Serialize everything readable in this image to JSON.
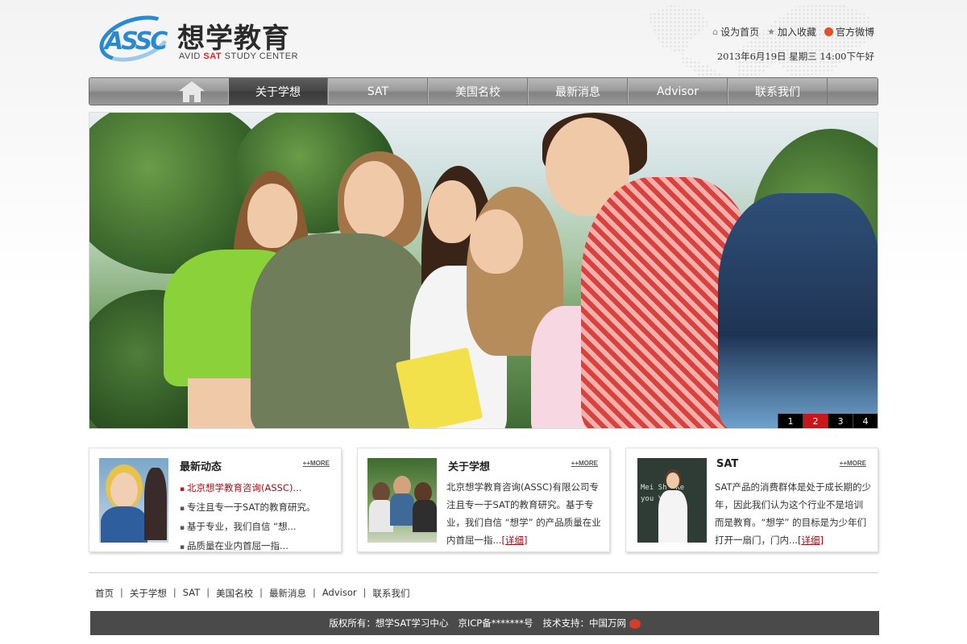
{
  "header": {
    "logo_abbr": "ASSC",
    "logo_cn": "想学教育",
    "logo_en_prefix": "AVID ",
    "logo_en_highlight": "SAT",
    "logo_en_suffix": " STUDY CENTER",
    "set_home": "设为首页",
    "add_favorite": "加入收藏",
    "weibo": "官方微博",
    "datetime": "2013年6月19日  星期三  14:00下午好"
  },
  "nav": {
    "items": [
      {
        "label": "关于学想",
        "active": true
      },
      {
        "label": "SAT",
        "active": false
      },
      {
        "label": "美国名校",
        "active": false
      },
      {
        "label": "最新消息",
        "active": false
      },
      {
        "label": "Advisor",
        "active": false
      },
      {
        "label": "联系我们",
        "active": false
      }
    ]
  },
  "banner": {
    "slides": [
      "1",
      "2",
      "3",
      "4"
    ],
    "active_slide": 2
  },
  "boxes": {
    "news": {
      "title": "最新动态",
      "more": "++MORE",
      "items": [
        "北京想学教育咨询(ASSC)...",
        "专注且专一于SAT的教育研究。",
        "基于专业，我们自信 “想...",
        "品质量在业内首屈一指..."
      ]
    },
    "about": {
      "title": "关于学想",
      "more": "++MORE",
      "text": "北京想学教育咨询(ASSC)有限公司专注且专一于SAT的教育研究。基于专业，我们自信 “想学” 的产品质量在业内首屈一指...",
      "detail": "[详细]"
    },
    "sat": {
      "title": "SAT",
      "more": "++MORE",
      "text": "SAT产品的消费群体是处于成长期的少年，因此我们认为这个行业不是培训而是教育。“想学” 的目标是为少年们打开一扇门，门内...",
      "detail": "[详细]"
    }
  },
  "footer": {
    "links": [
      "首页",
      "关于学想",
      "SAT",
      "美国名校",
      "最新消息",
      "Advisor",
      "联系我们"
    ],
    "copyright": "版权所有：想学SAT学习中心",
    "icp": "京ICP备*******号",
    "support": "技术支持：中国万网"
  },
  "colors": {
    "nav_active": "#444444",
    "accent_red": "#c8161d",
    "logo_blue": "#2a8ad1",
    "footer_bg": "#4a4a4a"
  }
}
